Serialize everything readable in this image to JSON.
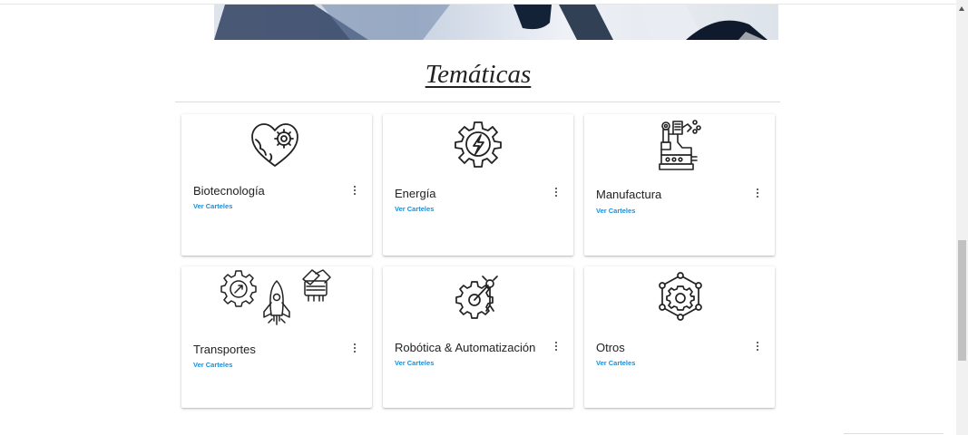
{
  "section": {
    "title": "Temáticas"
  },
  "cards": [
    {
      "title": "Biotecnología",
      "link": "Ver Carteles",
      "icon": "heart-gear-icon"
    },
    {
      "title": "Energía",
      "link": "Ver Carteles",
      "icon": "gear-lightning-icon"
    },
    {
      "title": "Manufactura",
      "link": "Ver Carteles",
      "icon": "industrial-machine-icon"
    },
    {
      "title": "Transportes",
      "link": "Ver Carteles",
      "icon": "rocket-gears-icon"
    },
    {
      "title": "Robótica & Automatización",
      "link": "Ver Carteles",
      "icon": "robot-arm-gear-icon"
    },
    {
      "title": "Otros",
      "link": "Ver Carteles",
      "icon": "gear-network-icon"
    }
  ],
  "colors": {
    "link": "#1a8fd6",
    "icon_stroke": "#222222"
  }
}
